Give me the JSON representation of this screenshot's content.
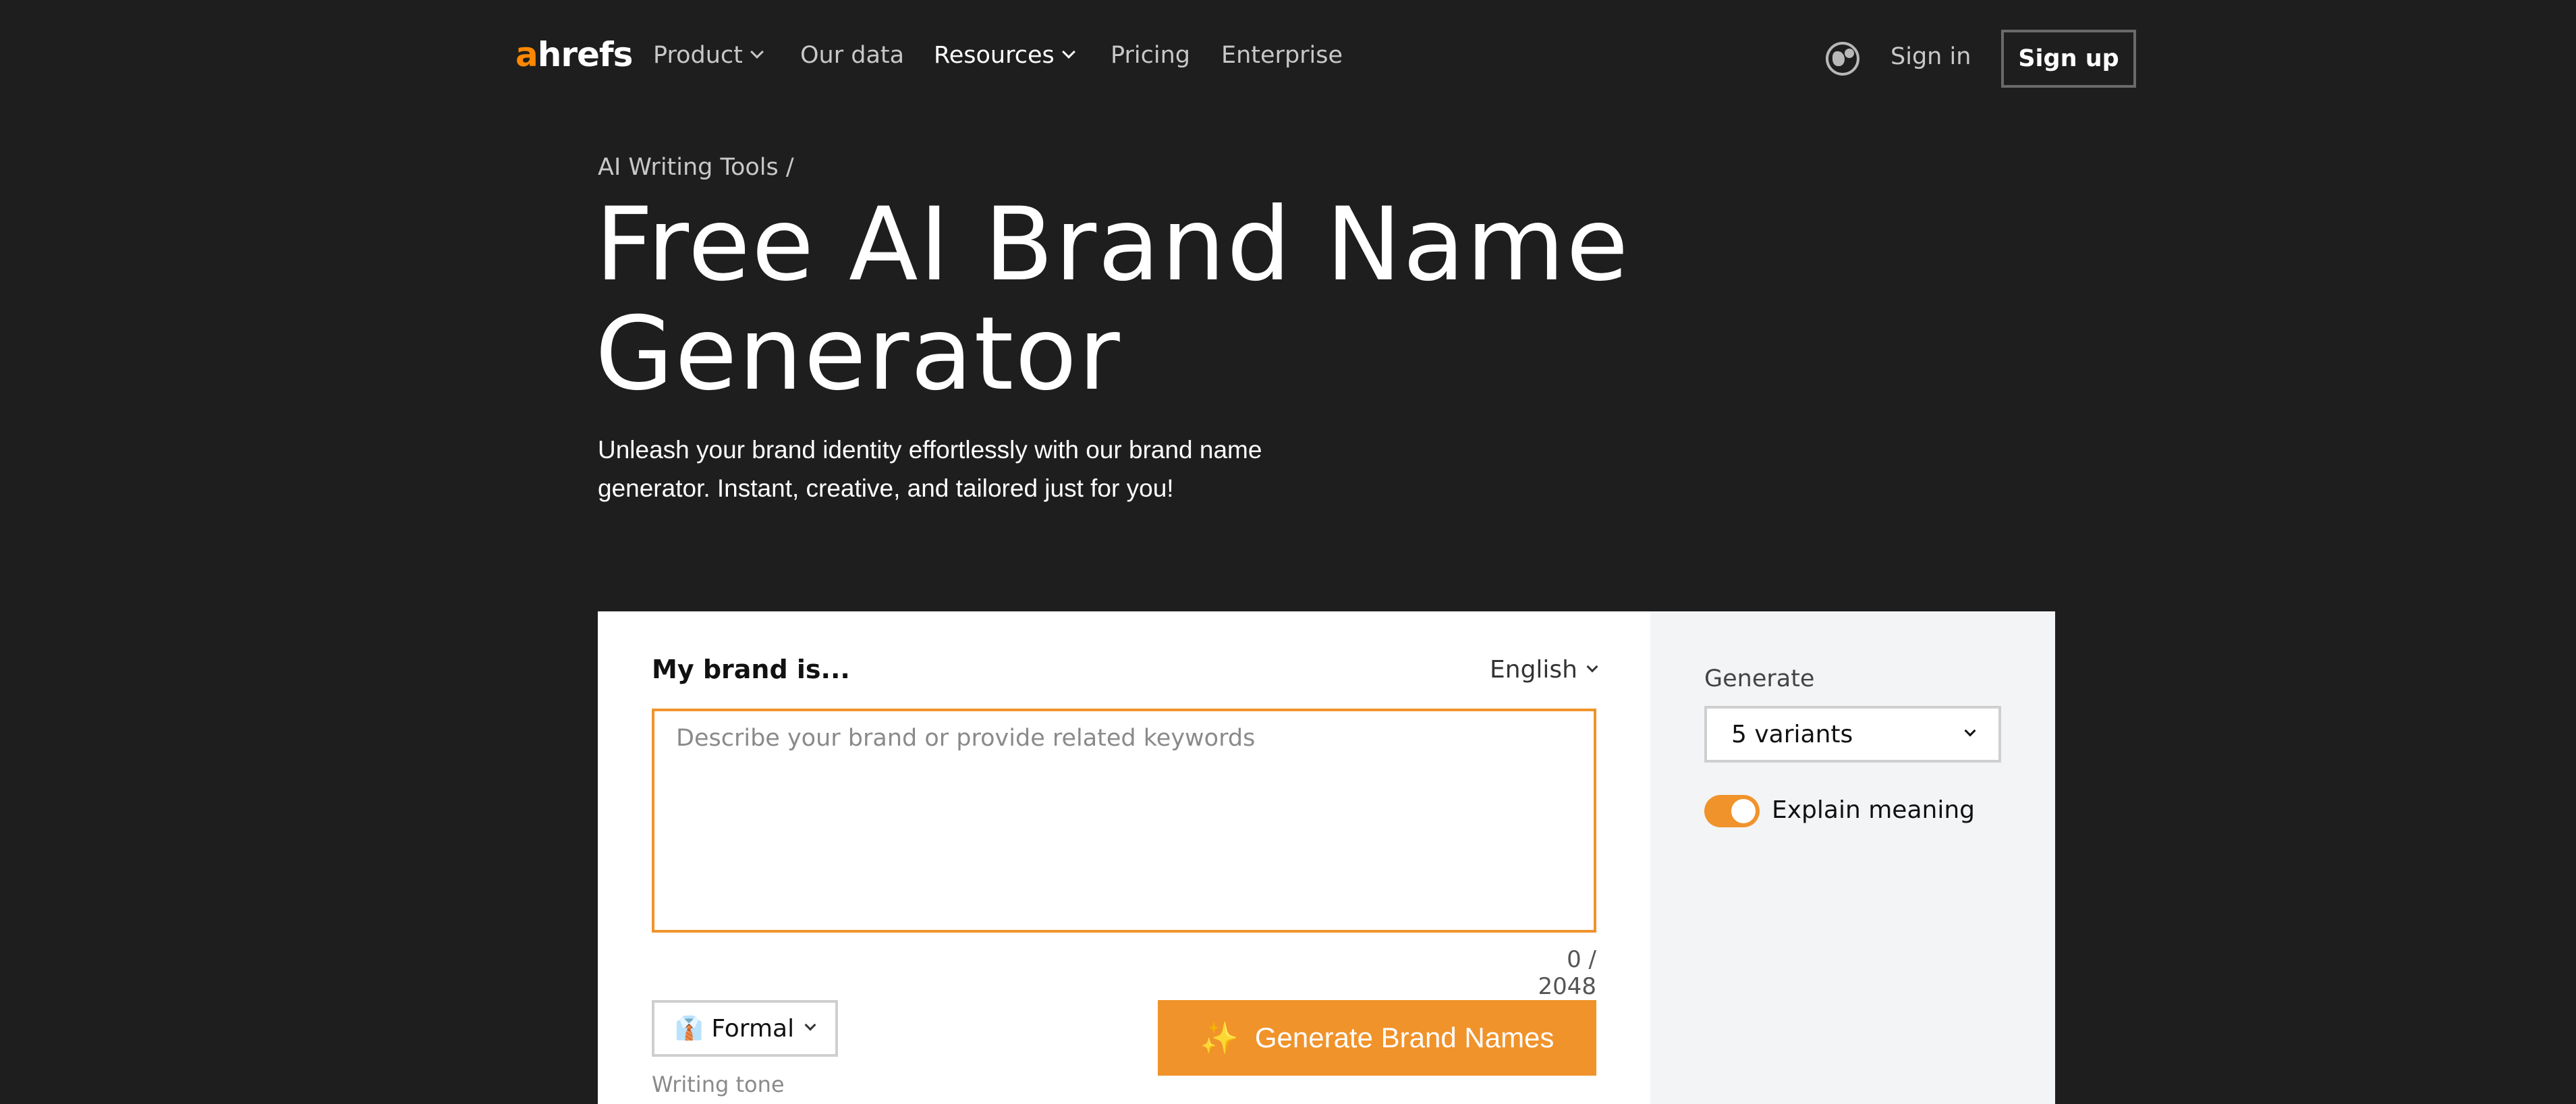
{
  "nav": {
    "logo_a": "a",
    "logo_rest": "hrefs",
    "items": [
      {
        "label": "Product",
        "has_dropdown": true
      },
      {
        "label": "Our data",
        "has_dropdown": false
      },
      {
        "label": "Resources",
        "has_dropdown": true
      },
      {
        "label": "Pricing",
        "has_dropdown": false
      },
      {
        "label": "Enterprise",
        "has_dropdown": false
      }
    ],
    "language_icon": "globe-icon",
    "signin": "Sign in",
    "signup": "Sign up"
  },
  "hero": {
    "breadcrumb": "AI Writing Tools /",
    "title": "Free AI Brand Name Generator",
    "subtitle": "Unleash your brand identity effortlessly with our brand name generator. Instant, creative, and tailored just for you!"
  },
  "tool": {
    "input_label": "My brand is...",
    "language": "English",
    "placeholder": "Describe your brand or provide related keywords",
    "value": "",
    "counter": "0 / 2048",
    "tone_emoji": "👔",
    "tone": "Formal",
    "tone_label": "Writing tone",
    "generate_button": "Generate Brand Names",
    "generate_icon": "sparkles-icon"
  },
  "options": {
    "generate_label": "Generate",
    "variants": "5 variants",
    "explain_label": "Explain meaning",
    "explain_enabled": true
  },
  "colors": {
    "accent": "#f0932b",
    "background": "#1e1e1e",
    "side_panel": "#f3f4f6"
  }
}
